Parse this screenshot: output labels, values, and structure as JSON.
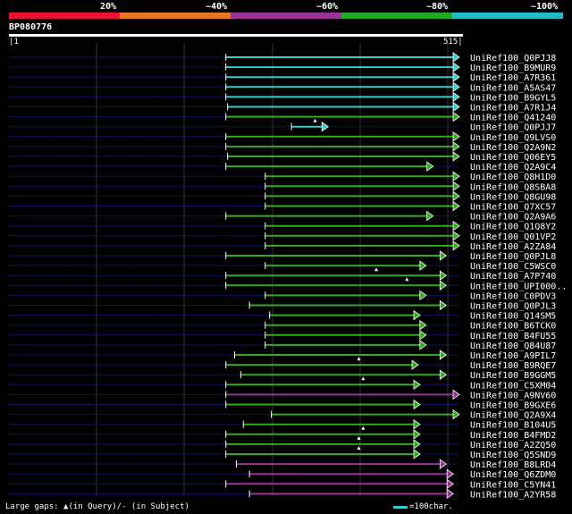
{
  "legend": {
    "segments": [
      {
        "label": "20%",
        "color": "#ee1133"
      },
      {
        "label": "~40%",
        "color": "#e87722"
      },
      {
        "label": "~60%",
        "color": "#993399"
      },
      {
        "label": "~80%",
        "color": "#22aa22"
      },
      {
        "label": "~100%",
        "color": "#22bbcc"
      }
    ]
  },
  "query": {
    "name": "BP080776",
    "start_label": "1",
    "end_label": "515",
    "length": 515
  },
  "colors": {
    "cyan": "#33cccc",
    "green": "#33aa22",
    "purple": "#993399",
    "navy": "#1a1a66",
    "grid": "#333333"
  },
  "hits": [
    {
      "id": "UniRef100_Q0PJJ8",
      "start": 248,
      "end": 515,
      "color": "cyan"
    },
    {
      "id": "UniRef100_B9MUR9",
      "start": 248,
      "end": 515,
      "color": "cyan"
    },
    {
      "id": "UniRef100_A7R361",
      "start": 248,
      "end": 515,
      "color": "cyan"
    },
    {
      "id": "UniRef100_A5AS47",
      "start": 248,
      "end": 515,
      "color": "cyan"
    },
    {
      "id": "UniRef100_B9GYL5",
      "start": 248,
      "end": 515,
      "color": "cyan"
    },
    {
      "id": "UniRef100_A7R1J4",
      "start": 250,
      "end": 515,
      "color": "cyan"
    },
    {
      "id": "UniRef100_Q41240",
      "start": 248,
      "end": 515,
      "color": "green"
    },
    {
      "id": "UniRef100_Q0PJJ7",
      "start": 323,
      "end": 365,
      "color": "cyan",
      "query_gap": 350
    },
    {
      "id": "UniRef100_Q9LVS0",
      "start": 248,
      "end": 515,
      "color": "green"
    },
    {
      "id": "UniRef100_Q2A9N2",
      "start": 248,
      "end": 515,
      "color": "green"
    },
    {
      "id": "UniRef100_Q06EY5",
      "start": 250,
      "end": 515,
      "color": "green"
    },
    {
      "id": "UniRef100_Q2A9C4",
      "start": 248,
      "end": 485,
      "color": "green"
    },
    {
      "id": "UniRef100_Q8H1D0",
      "start": 293,
      "end": 515,
      "color": "green"
    },
    {
      "id": "UniRef100_Q8SBA8",
      "start": 293,
      "end": 515,
      "color": "green"
    },
    {
      "id": "UniRef100_Q8GU98",
      "start": 293,
      "end": 515,
      "color": "green"
    },
    {
      "id": "UniRef100_Q7XC57",
      "start": 293,
      "end": 515,
      "color": "green"
    },
    {
      "id": "UniRef100_Q2A9A6",
      "start": 248,
      "end": 485,
      "color": "green"
    },
    {
      "id": "UniRef100_Q1Q8Y2",
      "start": 293,
      "end": 515,
      "color": "green"
    },
    {
      "id": "UniRef100_Q01VP2",
      "start": 293,
      "end": 515,
      "color": "green"
    },
    {
      "id": "UniRef100_A2ZA84",
      "start": 293,
      "end": 515,
      "color": "green"
    },
    {
      "id": "UniRef100_Q0PJL8",
      "start": 248,
      "end": 500,
      "color": "green"
    },
    {
      "id": "UniRef100_C5WSC0",
      "start": 293,
      "end": 477,
      "color": "green"
    },
    {
      "id": "UniRef100_A7P740",
      "start": 248,
      "end": 500,
      "color": "green",
      "query_gap": 420
    },
    {
      "id": "UniRef100_UPI000..",
      "start": 248,
      "end": 500,
      "color": "green",
      "query_gap": 455
    },
    {
      "id": "UniRef100_C0PDV3",
      "start": 293,
      "end": 477,
      "color": "green"
    },
    {
      "id": "UniRef100_Q0PJL3",
      "start": 275,
      "end": 500,
      "color": "green"
    },
    {
      "id": "UniRef100_Q14SM5",
      "start": 298,
      "end": 470,
      "color": "green"
    },
    {
      "id": "UniRef100_B6TCK0",
      "start": 293,
      "end": 477,
      "color": "green"
    },
    {
      "id": "UniRef100_B4FU55",
      "start": 293,
      "end": 477,
      "color": "green"
    },
    {
      "id": "UniRef100_Q84U87",
      "start": 293,
      "end": 477,
      "color": "green"
    },
    {
      "id": "UniRef100_A9PIL7",
      "start": 258,
      "end": 500,
      "color": "green"
    },
    {
      "id": "UniRef100_B9RQE7",
      "start": 248,
      "end": 468,
      "color": "green",
      "query_gap": 400
    },
    {
      "id": "UniRef100_B9GGM5",
      "start": 265,
      "end": 500,
      "color": "green"
    },
    {
      "id": "UniRef100_C5XM04",
      "start": 248,
      "end": 470,
      "color": "green",
      "query_gap": 405
    },
    {
      "id": "UniRef100_A9NV60",
      "start": 248,
      "end": 515,
      "color": "purple"
    },
    {
      "id": "UniRef100_B9GXE6",
      "start": 248,
      "end": 470,
      "color": "green"
    },
    {
      "id": "UniRef100_Q2A9X4",
      "start": 300,
      "end": 515,
      "color": "green"
    },
    {
      "id": "UniRef100_B104U5",
      "start": 268,
      "end": 470,
      "color": "green"
    },
    {
      "id": "UniRef100_B4FMD2",
      "start": 248,
      "end": 470,
      "color": "green",
      "query_gap": 405
    },
    {
      "id": "UniRef100_A2ZQ50",
      "start": 248,
      "end": 470,
      "color": "green",
      "query_gap": 400
    },
    {
      "id": "UniRef100_Q5SND9",
      "start": 248,
      "end": 470,
      "color": "green",
      "query_gap": 400
    },
    {
      "id": "UniRef100_B8LRD4",
      "start": 260,
      "end": 500,
      "color": "purple"
    },
    {
      "id": "UniRef100_Q6ZDM0",
      "start": 275,
      "end": 508,
      "color": "purple"
    },
    {
      "id": "UniRef100_C5YN41",
      "start": 248,
      "end": 508,
      "color": "purple"
    },
    {
      "id": "UniRef100_A2YR58",
      "start": 275,
      "end": 508,
      "color": "purple"
    }
  ],
  "footer": {
    "left": "Large gaps: ▲(in Query)/- (in Subject)",
    "right": "=100char."
  }
}
